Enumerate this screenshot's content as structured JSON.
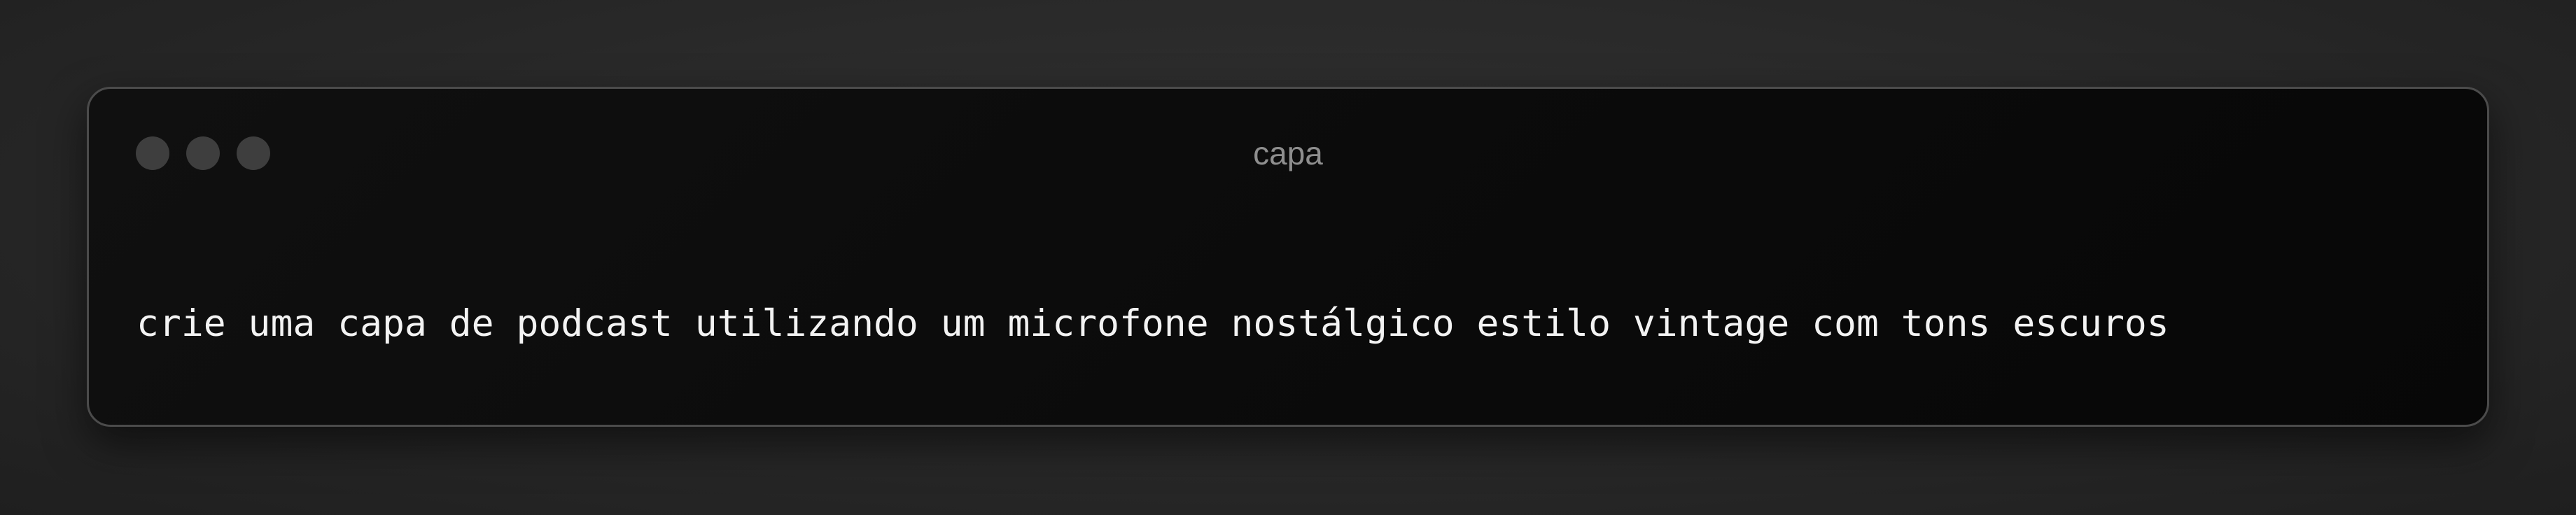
{
  "window": {
    "title": "capa",
    "traffic_lights": [
      "close",
      "minimize",
      "maximize"
    ]
  },
  "content": {
    "prompt_text": "crie uma capa de podcast utilizando um microfone nostálgico estilo vintage com tons escuros"
  },
  "colors": {
    "background": "#2a2a2a",
    "window_background": "#0b0b0b",
    "window_border": "#4b4b4b",
    "traffic_light": "#3e3e3e",
    "title_text": "#8e8e8e",
    "prompt_text": "#f3f3f3"
  }
}
